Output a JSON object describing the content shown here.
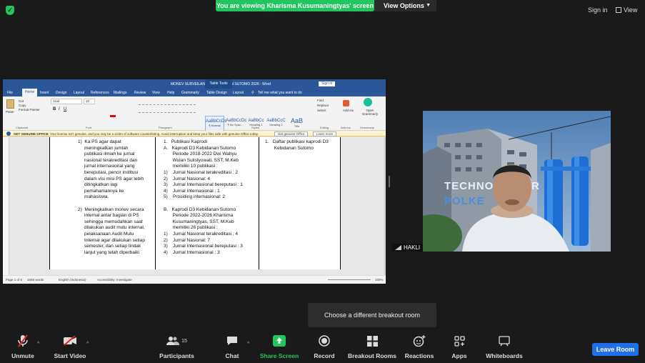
{
  "top": {
    "banner_text": "You are viewing Kharisma Kusumaningtyas' screen",
    "view_options": "View Options",
    "sign_in": "Sign in",
    "view": "View"
  },
  "word": {
    "title": "MONEV SURVEILANS DI KEBIDANAN SUTOMO 2026 - Word",
    "table_tools": "Table Tools",
    "sign_in": "Sign in",
    "tabs": [
      "File",
      "Home",
      "Insert",
      "Design",
      "Layout",
      "References",
      "Mailings",
      "Review",
      "View",
      "Help",
      "Grammarly",
      "Table Design",
      "Layout"
    ],
    "tell_me": "Tell me what you want to do",
    "font_name": "Arial",
    "font_size": "10",
    "styles": [
      {
        "sample": "AaBbCcDc",
        "name": "¶ Normal"
      },
      {
        "sample": "AaBbCcDc",
        "name": "¶ No Spac..."
      },
      {
        "sample": "AaBbCc",
        "name": "Heading 1"
      },
      {
        "sample": "AaBbCcC",
        "name": "Heading 2"
      },
      {
        "sample": "AaB",
        "name": "Title"
      }
    ],
    "group_labels": [
      "Clipboard",
      "Font",
      "Paragraph",
      "Styles",
      "Editing",
      "Add-ins",
      "Grammarly"
    ],
    "clip_items": [
      "Cut",
      "Copy",
      "Format Painter"
    ],
    "editing_items": [
      "Find",
      "Replace",
      "Select"
    ],
    "addins_label": "Add-ins",
    "grammarly_label": "Open Grammarly",
    "paste_label": "Paste",
    "genuine": {
      "label": "GET GENUINE OFFICE",
      "message": "Your license isn't genuine, and you may be a victim of software counterfeiting. Avoid interruption and keep your files safe with genuine Office today.",
      "btn1": "Get genuine Office",
      "btn2": "Learn more"
    },
    "status": {
      "page": "Page 1 of 6",
      "words": "1668 words",
      "lang": "English (Indonesia)",
      "accessibility": "Accessibility: Investigate",
      "zoom": "100%"
    },
    "doc": {
      "col1": [
        "1)  Ka PS agar dapat",
        "     meningkatkan jumlah",
        "     publikasi ilmiah ke jurnal",
        "     nasional terakreditasi dan",
        "     jurnal internasional yang",
        "     bereputasi, pencir institusi",
        "     dalam visi misi PS agar lebih",
        "     ditingkatkan lagi",
        "     pemahamannya ke",
        "     mahasiswa.",
        "",
        "2)  Meningkatkan monev secara",
        "     internal antar bagian di PS",
        "     sehingga memudahkan saat",
        "     dilakukan audit mutu internal,",
        "     pelaksanaan Audit Mutu",
        "     Internal agar dilakukan setiap",
        "     semester, dan setiap tindak",
        "     lanjut yang telah diperbaiki"
      ],
      "col2": [
        "1.   Publikasi Kaprodi",
        "A.   Kaprodi D3 Kebidanan Sutomo",
        "       Periode 2018-2022 Dwi Wahyu",
        "       Wulan Sulistyowati, SST, M.Keb",
        "       memiliki 10 publikasi :",
        "1)    Jurnal Nasional terakreditasi : 2",
        "2)    Jurnal Nasional: 4",
        "3)    Jurnal Internasional bereputasi : 1",
        "4)    Jurnal Internasional : 1",
        "5)    Prosiding internasional: 2",
        "",
        "B.   Kaprodi D3 Kebidanan Sutomo",
        "       Periode 2022-2026 Kharisma",
        "       Kusumaningtyas, SST, M.Keb",
        "       memiliki 26 publikasi :",
        "1)    Jurnal Nasional terakreditasi : 4",
        "2)    Jurnal Nasional: 7",
        "3)    Jurnal Internasional bereputasi : 3",
        "4)    Jurnal Internasional : 3"
      ],
      "col3": [
        "1.   Daftar publikasi kaprodi D3",
        "       Kebidanan Sutomo"
      ]
    }
  },
  "video": {
    "participant_name": "HAKLI",
    "background_text_1": "TECHNO",
    "background_text_2": "POLKE",
    "background_text_3": "R"
  },
  "tooltip": "Choose a different breakout room",
  "toolbar": {
    "items": [
      {
        "label": "Unmute",
        "icon": "mic-muted-icon"
      },
      {
        "label": "Start Video",
        "icon": "video-off-icon"
      },
      {
        "label": "Participants",
        "icon": "participants-icon",
        "count": "15"
      },
      {
        "label": "Chat",
        "icon": "chat-icon"
      },
      {
        "label": "Share Screen",
        "icon": "share-screen-icon"
      },
      {
        "label": "Record",
        "icon": "record-icon"
      },
      {
        "label": "Breakout Rooms",
        "icon": "breakout-rooms-icon"
      },
      {
        "label": "Reactions",
        "icon": "reactions-icon"
      },
      {
        "label": "Apps",
        "icon": "apps-icon"
      },
      {
        "label": "Whiteboards",
        "icon": "whiteboards-icon"
      }
    ],
    "leave": "Leave Room"
  },
  "colors": {
    "accent_green": "#22c55e",
    "word_blue": "#2b579a",
    "leave_blue": "#1f6feb",
    "muted_red": "#e02424"
  }
}
